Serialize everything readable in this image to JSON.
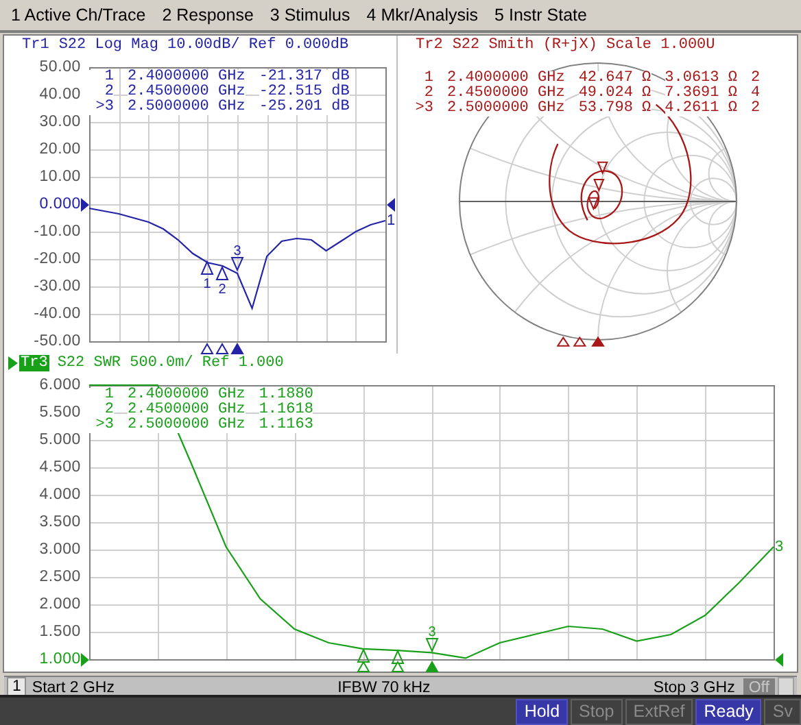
{
  "menu": [
    {
      "label": "1 Active Ch/Trace"
    },
    {
      "label": "2 Response"
    },
    {
      "label": "3 Stimulus"
    },
    {
      "label": "4 Mkr/Analysis"
    },
    {
      "label": "5 Instr State"
    }
  ],
  "traces": [
    {
      "kind": "rectangular",
      "name": "Tr1",
      "title": "S22 Log Mag 10.00dB/ Ref 0.000dB",
      "active": false,
      "color": "#2323a8",
      "chart_data": {
        "type": "line",
        "categories": [
          null,
          null,
          null,
          null,
          null,
          null,
          null,
          null,
          null,
          null,
          null,
          null,
          null,
          null,
          null,
          null,
          null,
          null,
          null,
          null,
          null
        ],
        "ylim": [
          -50,
          50
        ],
        "yticks": [
          {
            "value": 50,
            "label": "50.00"
          },
          {
            "value": 40,
            "label": "40.00"
          },
          {
            "value": 30,
            "label": "30.00"
          },
          {
            "value": 20,
            "label": "20.00"
          },
          {
            "value": 10,
            "label": "10.00"
          },
          {
            "value": 0,
            "label": "0.000"
          },
          {
            "value": -10,
            "label": "-10.00"
          },
          {
            "value": -20,
            "label": "-20.00"
          },
          {
            "value": -30,
            "label": "-30.00"
          },
          {
            "value": -40,
            "label": "-40.00"
          },
          {
            "value": -50,
            "label": "-50.00"
          }
        ],
        "series": [
          {
            "color": "#2323a8",
            "values": [
              -1.5,
              -2.5,
              -3.5,
              -5,
              -6.5,
              -9,
              -13,
              -18,
              -21.3,
              -22.5,
              -25.2,
              -38,
              -19,
              -13.5,
              -12.5,
              -13,
              -17,
              -13.5,
              -10,
              -7.5,
              -6
            ]
          }
        ],
        "grid": true
      },
      "tick_states": [
        {
          "reference": false
        },
        {
          "reference": false
        },
        {
          "reference": false
        },
        {
          "reference": false
        },
        {
          "reference": false
        },
        {
          "reference": true
        },
        {
          "reference": false
        },
        {
          "reference": false
        },
        {
          "reference": false
        },
        {
          "reference": false
        },
        {
          "reference": false
        }
      ],
      "readouts": [
        {
          "marker": "1",
          "frequency": "2.4000000 GHz",
          "values": [
            "-21.317 dB"
          ]
        },
        {
          "marker": "2",
          "frequency": "2.4500000 GHz",
          "values": [
            "-22.515 dB"
          ]
        },
        {
          "marker": ">3",
          "frequency": "2.5000000 GHz",
          "values": [
            "-25.201 dB"
          ]
        }
      ],
      "markers": [
        {
          "label": "1",
          "active": false
        },
        {
          "label": "2",
          "active": false
        },
        {
          "label": "3",
          "active": true
        }
      ],
      "end_label": "1"
    },
    {
      "kind": "smith",
      "name": "Tr2",
      "title": "S22 Smith (R+jX) Scale 1.000U",
      "active": false,
      "color": "#a81818",
      "readouts": [
        {
          "marker": "1",
          "frequency": "2.4000000 GHz",
          "values": [
            "42.647 Ω",
            "3.0613 Ω",
            "2"
          ]
        },
        {
          "marker": "2",
          "frequency": "2.4500000 GHz",
          "values": [
            "49.024 Ω",
            "7.3691 Ω",
            "4"
          ]
        },
        {
          "marker": ">3",
          "frequency": "2.5000000 GHz",
          "values": [
            "53.798 Ω",
            "4.2611 Ω",
            "2"
          ]
        }
      ],
      "markers": [
        {
          "active": false
        },
        {
          "active": false
        },
        {
          "active": true
        }
      ]
    },
    {
      "kind": "rectangular",
      "name": "Tr3",
      "title": "S22 SWR 500.0m/ Ref 1.000",
      "active": true,
      "color": "#18a018",
      "chart_data": {
        "type": "line",
        "categories": [
          null,
          null,
          null,
          null,
          null,
          null,
          null,
          null,
          null,
          null,
          null,
          null,
          null,
          null,
          null,
          null,
          null,
          null,
          null,
          null,
          null
        ],
        "ylim": [
          1,
          6
        ],
        "yticks": [
          {
            "value": 6,
            "label": "6.000"
          },
          {
            "value": 5.5,
            "label": "5.500"
          },
          {
            "value": 5,
            "label": "5.000"
          },
          {
            "value": 4.5,
            "label": "4.500"
          },
          {
            "value": 4,
            "label": "4.000"
          },
          {
            "value": 3.5,
            "label": "3.500"
          },
          {
            "value": 3,
            "label": "3.000"
          },
          {
            "value": 2.5,
            "label": "2.500"
          },
          {
            "value": 2,
            "label": "2.000"
          },
          {
            "value": 1.5,
            "label": "1.500"
          },
          {
            "value": 1,
            "label": "1.000"
          }
        ],
        "series": [
          {
            "color": "#18a018",
            "values": [
              6,
              6,
              6,
              4.55,
              3.05,
              2.1,
              1.55,
              1.3,
              1.19,
              1.16,
              1.12,
              1.02,
              1.3,
              1.45,
              1.6,
              1.55,
              1.33,
              1.45,
              1.8,
              2.4,
              3.05
            ]
          }
        ],
        "grid": true
      },
      "tick_states": [
        {
          "reference": false
        },
        {
          "reference": false
        },
        {
          "reference": false
        },
        {
          "reference": false
        },
        {
          "reference": false
        },
        {
          "reference": false
        },
        {
          "reference": false
        },
        {
          "reference": false
        },
        {
          "reference": false
        },
        {
          "reference": false
        },
        {
          "reference": true
        }
      ],
      "readouts": [
        {
          "marker": "1",
          "frequency": "2.4000000 GHz",
          "values": [
            "1.1880"
          ]
        },
        {
          "marker": "2",
          "frequency": "2.4500000 GHz",
          "values": [
            "1.1618"
          ]
        },
        {
          "marker": ">3",
          "frequency": "2.5000000 GHz",
          "values": [
            "1.1163"
          ]
        }
      ],
      "markers": [
        {
          "active": false
        },
        {
          "active": false
        },
        {
          "label": "3",
          "active": true
        }
      ],
      "end_label": "3"
    }
  ],
  "status_bar": {
    "channel": "1",
    "start": "Start 2 GHz",
    "ifbw": "IFBW 70 kHz",
    "stop": "Stop 3 GHz",
    "button": "Off"
  },
  "indicators": [
    {
      "label": "Hold",
      "on": true
    },
    {
      "label": "Stop",
      "on": false
    },
    {
      "label": "ExtRef",
      "on": false
    },
    {
      "label": "Ready",
      "on": true
    },
    {
      "label": "Sv",
      "on": false
    }
  ]
}
